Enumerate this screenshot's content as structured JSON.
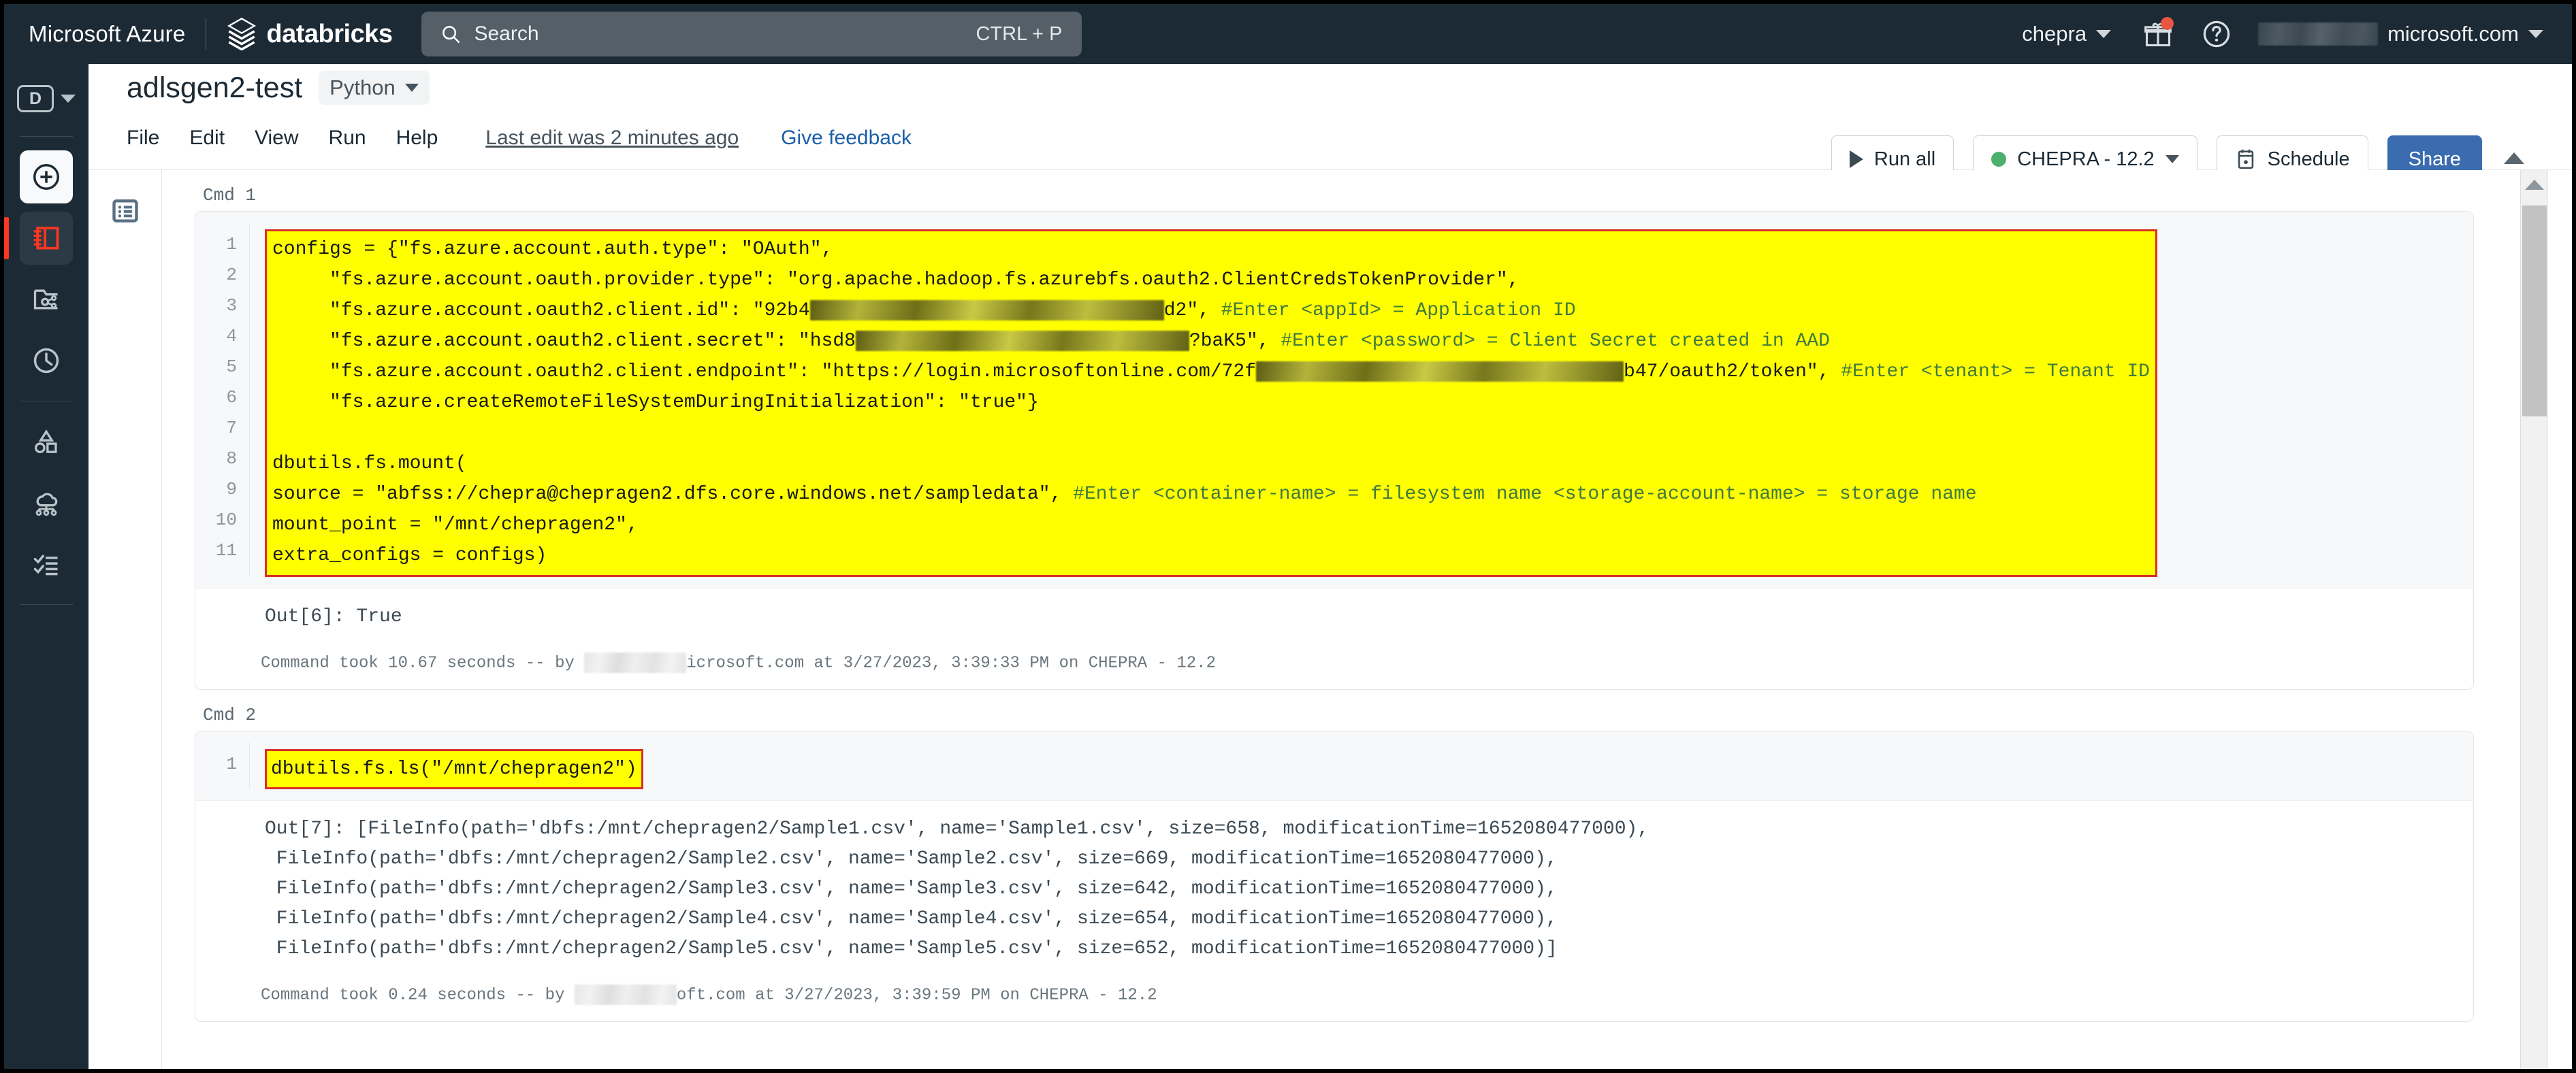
{
  "topbar": {
    "azure_brand": "Microsoft Azure",
    "databricks_word": "databricks",
    "databricks_logo_icon": "databricks-logo-icon",
    "search": {
      "icon": "search-icon",
      "placeholder": "Search",
      "shortcut": "CTRL + P"
    },
    "workspace_menu": "chepra",
    "gift_icon": "gift-icon",
    "help_icon": "help-circle-icon",
    "account_email_suffix": "microsoft.com"
  },
  "left_rail": {
    "logo_letter": "D",
    "items": [
      {
        "name": "new-button",
        "icon": "plus-circle-icon",
        "active": false
      },
      {
        "name": "workspace-notebook",
        "icon": "notebook-icon",
        "active": true
      },
      {
        "name": "repos",
        "icon": "folder-git-icon",
        "active": false
      },
      {
        "name": "recents",
        "icon": "clock-icon",
        "active": false
      },
      {
        "name": "data-catalog",
        "icon": "shapes-icon",
        "active": false
      },
      {
        "name": "compute",
        "icon": "cloud-cluster-icon",
        "active": false
      },
      {
        "name": "workflows",
        "icon": "checklist-icon",
        "active": false
      }
    ]
  },
  "notebook": {
    "title": "adlsgen2-test",
    "language": "Python",
    "menus": [
      "File",
      "Edit",
      "View",
      "Run",
      "Help"
    ],
    "last_edit": "Last edit was 2 minutes ago",
    "feedback": "Give feedback",
    "run_all": "Run all",
    "cluster": "CHEPRA - 12.2",
    "cluster_status_color": "#4caf6d",
    "schedule": "Schedule",
    "schedule_icon": "calendar-icon",
    "share": "Share",
    "share_color": "#3b6cb0",
    "toc_icon": "table-of-contents-icon"
  },
  "cells": [
    {
      "label": "Cmd 1",
      "line_numbers": "1\n2\n3\n4\n5\n6\n7\n8\n9\n10\n11",
      "code_segments": [
        {
          "t": "configs = {\"fs.azure.account.auth.type\": \"OAuth\",\n     \"fs.azure.account.oauth.provider.type\": \"org.apache.hadoop.fs.azurebfs.oauth2.ClientCredsTokenProvider\",\n     \"fs.azure.account.oauth2.client.id\": \"92b4",
          "k": "code"
        },
        {
          "t": "REDACT:520",
          "k": "redact-yellow"
        },
        {
          "t": "d2\", ",
          "k": "code"
        },
        {
          "t": "#Enter <appId> = Application ID",
          "k": "comment"
        },
        {
          "t": "\n     \"fs.azure.account.oauth2.client.secret\": \"hsd8",
          "k": "code"
        },
        {
          "t": "REDACT:490",
          "k": "redact-yellow"
        },
        {
          "t": "?baK5\", ",
          "k": "code"
        },
        {
          "t": "#Enter <password> = Client Secret created in AAD",
          "k": "comment"
        },
        {
          "t": "\n     \"fs.azure.account.oauth2.client.endpoint\": \"https://login.microsoftonline.com/72f",
          "k": "code"
        },
        {
          "t": "REDACT:540",
          "k": "redact-yellow"
        },
        {
          "t": "b47/oauth2/token\", ",
          "k": "code"
        },
        {
          "t": "#Enter <tenant> = Tenant ID",
          "k": "comment"
        },
        {
          "t": "\n     \"fs.azure.createRemoteFileSystemDuringInitialization\": \"true\"}\n\ndbutils.fs.mount(\nsource = \"abfss://chepra@chepragen2.dfs.core.windows.net/sampledata\", ",
          "k": "code"
        },
        {
          "t": "#Enter <container-name> = filesystem name <storage-account-name> = storage name",
          "k": "comment"
        },
        {
          "t": "\nmount_point = \"/mnt/chepragen2\",\nextra_configs = configs)",
          "k": "code"
        }
      ],
      "output": "Out[6]: True",
      "status_prefix": "Command took 10.67 seconds -- by ",
      "status_suffix": "icrosoft.com at 3/27/2023, 3:39:33 PM on CHEPRA - 12.2"
    },
    {
      "label": "Cmd 2",
      "line_numbers": "1",
      "code_inline": "dbutils.fs.ls(\"/mnt/chepragen2\")",
      "output": "Out[7]: [FileInfo(path='dbfs:/mnt/chepragen2/Sample1.csv', name='Sample1.csv', size=658, modificationTime=1652080477000),\n FileInfo(path='dbfs:/mnt/chepragen2/Sample2.csv', name='Sample2.csv', size=669, modificationTime=1652080477000),\n FileInfo(path='dbfs:/mnt/chepragen2/Sample3.csv', name='Sample3.csv', size=642, modificationTime=1652080477000),\n FileInfo(path='dbfs:/mnt/chepragen2/Sample4.csv', name='Sample4.csv', size=654, modificationTime=1652080477000),\n FileInfo(path='dbfs:/mnt/chepragen2/Sample5.csv', name='Sample5.csv', size=652, modificationTime=1652080477000)]",
      "status_prefix": "Command took 0.24 seconds -- by ",
      "status_suffix": "oft.com at 3/27/2023, 3:39:59 PM on CHEPRA - 12.2"
    }
  ]
}
